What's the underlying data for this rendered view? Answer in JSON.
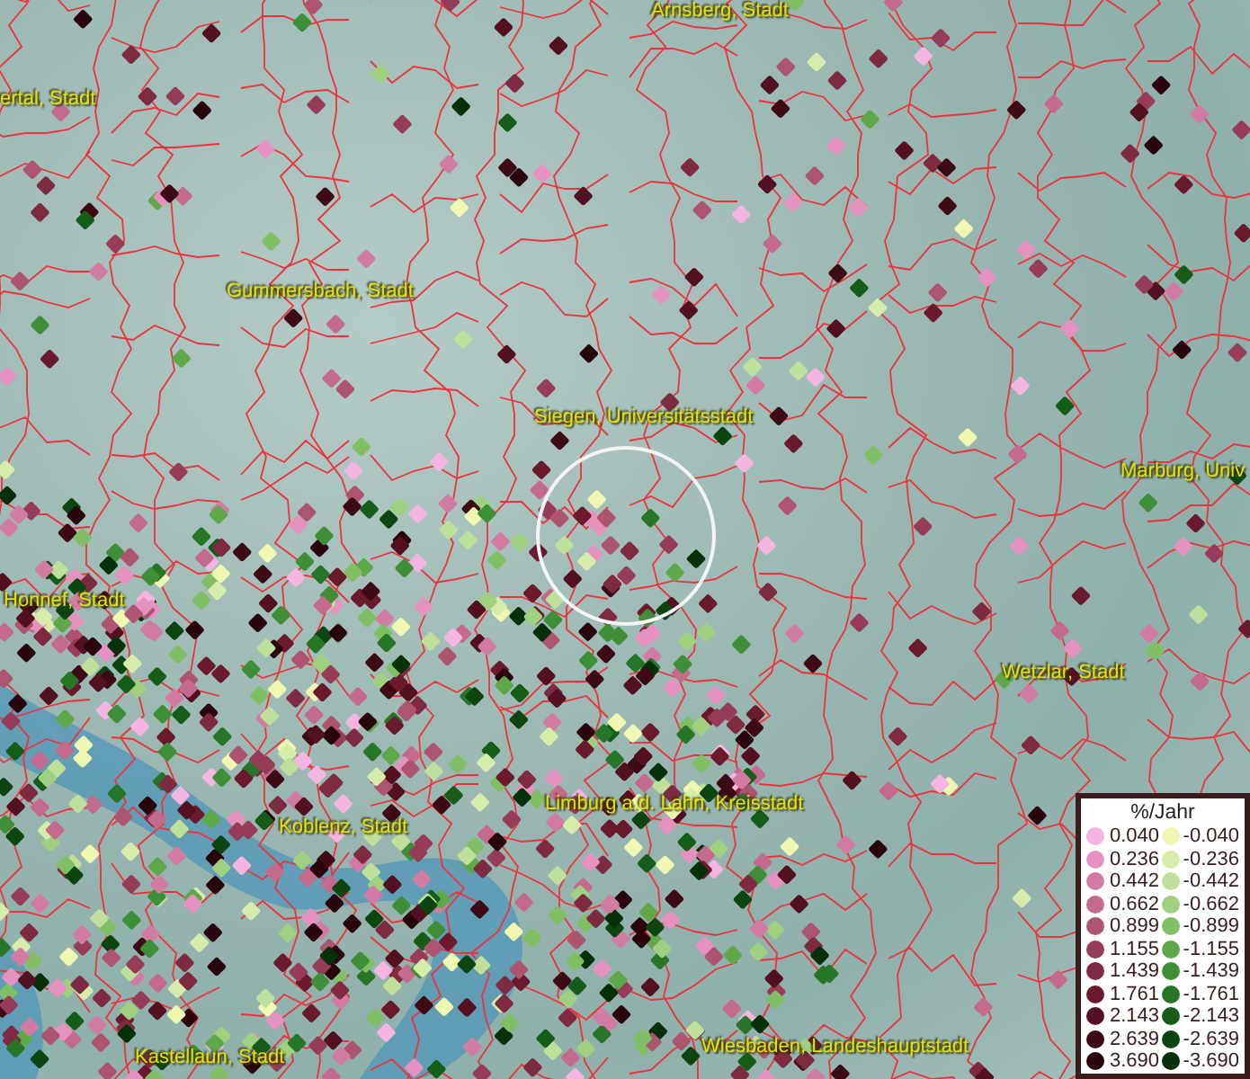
{
  "map": {
    "places": [
      {
        "name": "Arnsberg, Stadt"
      },
      {
        "name": "ertal, Stadt"
      },
      {
        "name": "Gummersbach, Stadt"
      },
      {
        "name": "Siegen, Universitätsstadt"
      },
      {
        "name": "Marburg, Univ"
      },
      {
        "name": "Honnef, Stadt"
      },
      {
        "name": "Wetzlar, Stadt"
      },
      {
        "name": "Limburg a.d. Lahn, Kreisstadt"
      },
      {
        "name": "Koblenz, Stadt"
      },
      {
        "name": "Wiesbaden, Landeshauptstadt"
      },
      {
        "name": "Kastellaun, Stadt"
      }
    ]
  },
  "legend": {
    "title": "%/Jahr",
    "rows": [
      {
        "positive": {
          "label": "0.040",
          "color": "#f4b6e0"
        },
        "negative": {
          "label": "-0.040",
          "color": "#f0f7b0"
        }
      },
      {
        "positive": {
          "label": "0.236",
          "color": "#e592c0"
        },
        "negative": {
          "label": "-0.236",
          "color": "#d6ecaa"
        }
      },
      {
        "positive": {
          "label": "0.442",
          "color": "#d27ca4"
        },
        "negative": {
          "label": "-0.442",
          "color": "#bfe09a"
        }
      },
      {
        "positive": {
          "label": "0.662",
          "color": "#c46a8c"
        },
        "negative": {
          "label": "-0.662",
          "color": "#9fd080"
        }
      },
      {
        "positive": {
          "label": "0.899",
          "color": "#ad5470"
        },
        "negative": {
          "label": "-0.899",
          "color": "#80bf64"
        }
      },
      {
        "positive": {
          "label": "1.155",
          "color": "#963c58"
        },
        "negative": {
          "label": "-1.155",
          "color": "#5ea84a"
        }
      },
      {
        "positive": {
          "label": "1.439",
          "color": "#7e2a40"
        },
        "negative": {
          "label": "-1.439",
          "color": "#3f8f38"
        }
      },
      {
        "positive": {
          "label": "1.761",
          "color": "#6a1a2c"
        },
        "negative": {
          "label": "-1.761",
          "color": "#277628"
        }
      },
      {
        "positive": {
          "label": "2.143",
          "color": "#521020"
        },
        "negative": {
          "label": "-2.143",
          "color": "#155d18"
        }
      },
      {
        "positive": {
          "label": "2.639",
          "color": "#3e0a16"
        },
        "negative": {
          "label": "-2.639",
          "color": "#0c4510"
        }
      },
      {
        "positive": {
          "label": "3.690",
          "color": "#2a040c"
        },
        "negative": {
          "label": "-3.690",
          "color": "#063008"
        }
      }
    ]
  }
}
